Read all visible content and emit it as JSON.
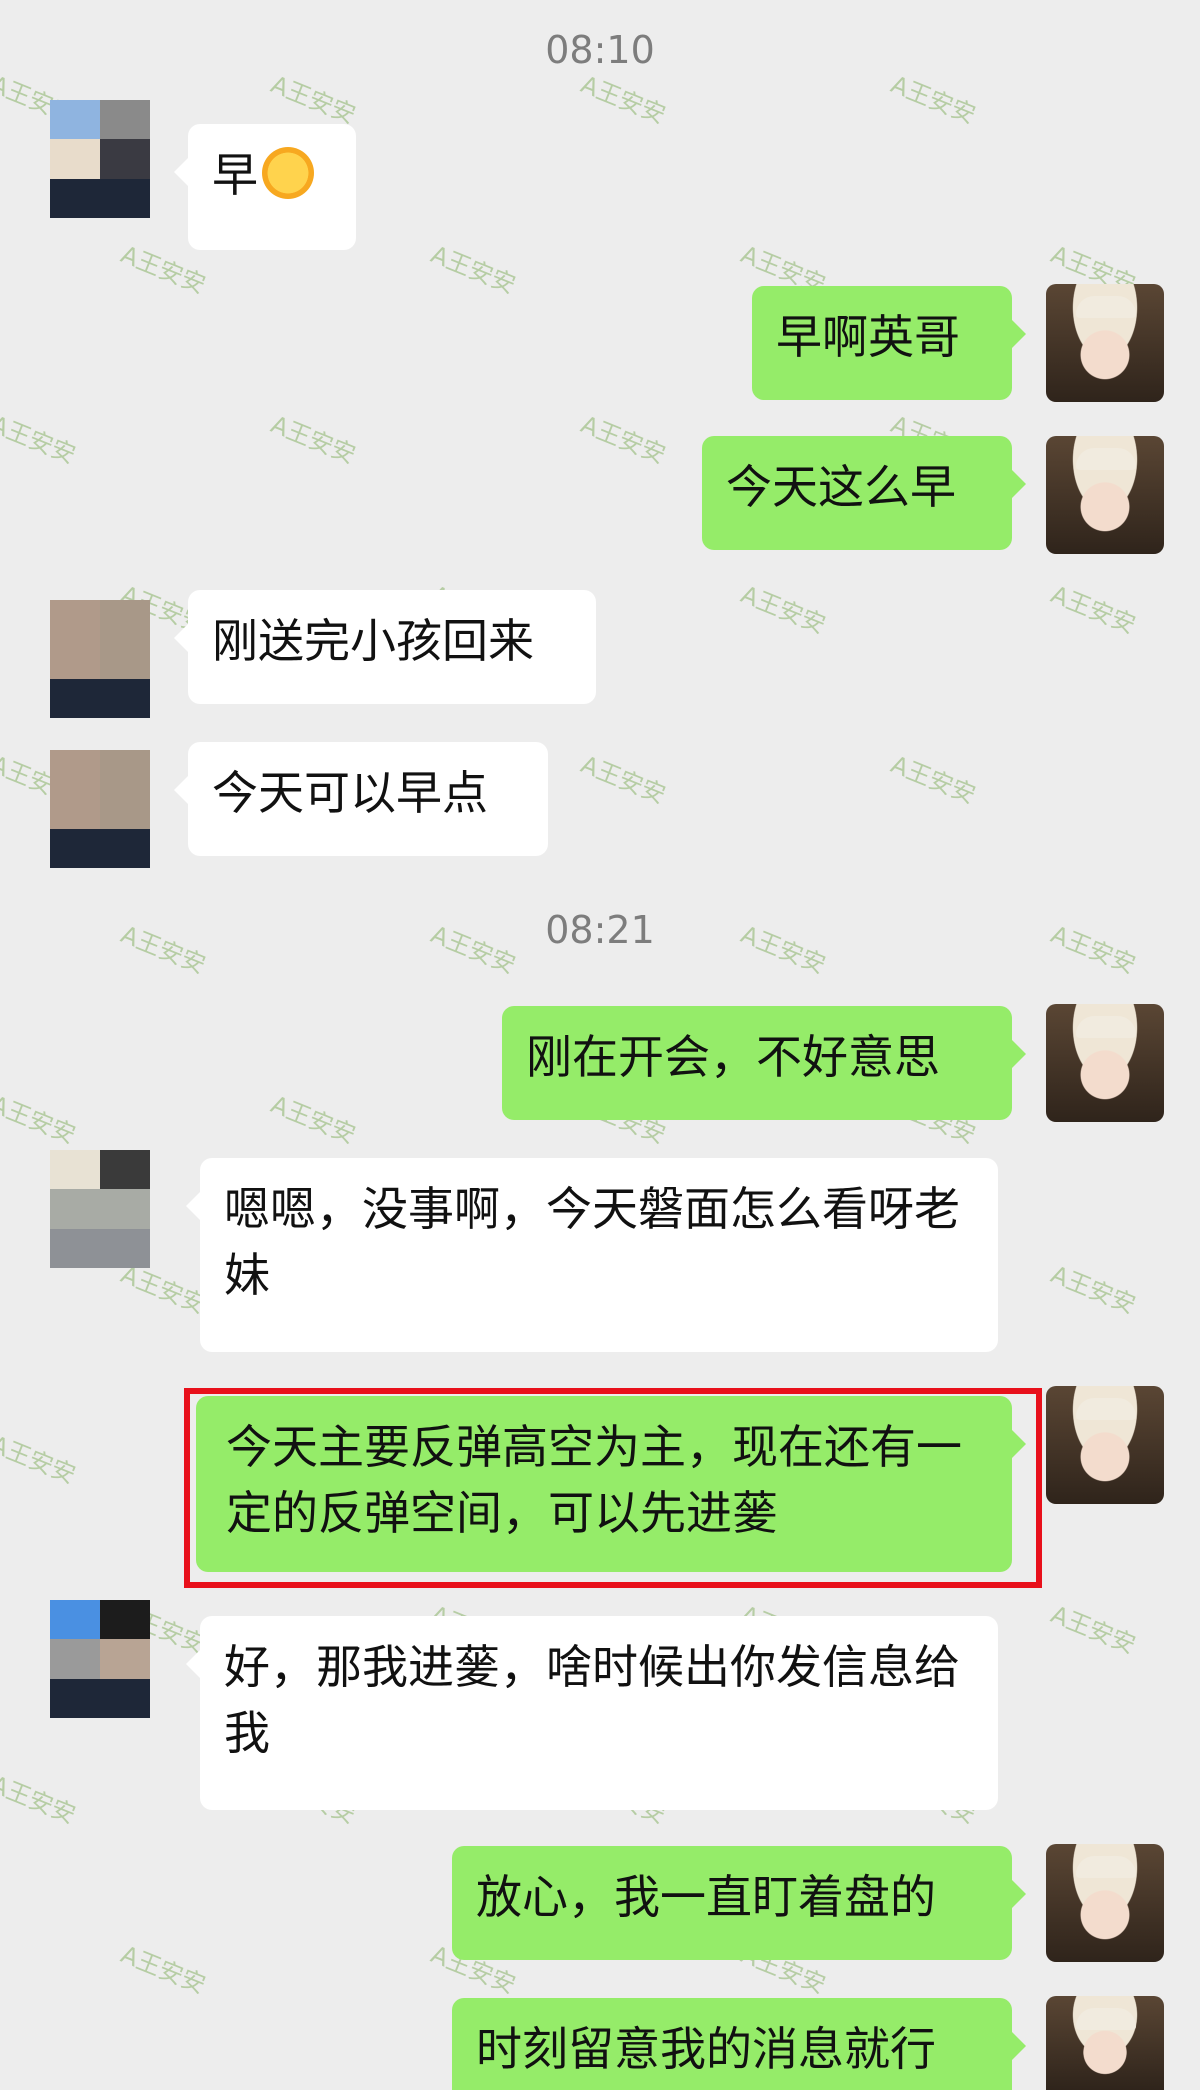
{
  "watermark": "A王安安",
  "timestamps": [
    "08:10",
    "08:21"
  ],
  "messages": [
    {
      "side": "left",
      "text": "早",
      "emoji": "sun-emoji"
    },
    {
      "side": "right",
      "text": "早啊英哥"
    },
    {
      "side": "right",
      "text": "今天这么早"
    },
    {
      "side": "left",
      "text": "刚送完小孩回来"
    },
    {
      "side": "left",
      "text": "今天可以早点"
    },
    {
      "side": "right",
      "text": "刚在开会，不好意思"
    },
    {
      "side": "left",
      "text": "嗯嗯，没事啊，今天磐面怎么看呀老妹"
    },
    {
      "side": "right",
      "text": "今天主要反弹高空为主，现在还有一定的反弹空间，可以先进蓌",
      "highlighted": true
    },
    {
      "side": "left",
      "text": "好，那我进蓌，啥时候出你发信息给我"
    },
    {
      "side": "right",
      "text": "放心，我一直盯着盘的"
    },
    {
      "side": "right",
      "text": "时刻留意我的消息就行"
    }
  ],
  "colors": {
    "background": "#ededed",
    "right_bubble": "#95ec69",
    "left_bubble": "#ffffff",
    "highlight_box": "#e8101b"
  }
}
